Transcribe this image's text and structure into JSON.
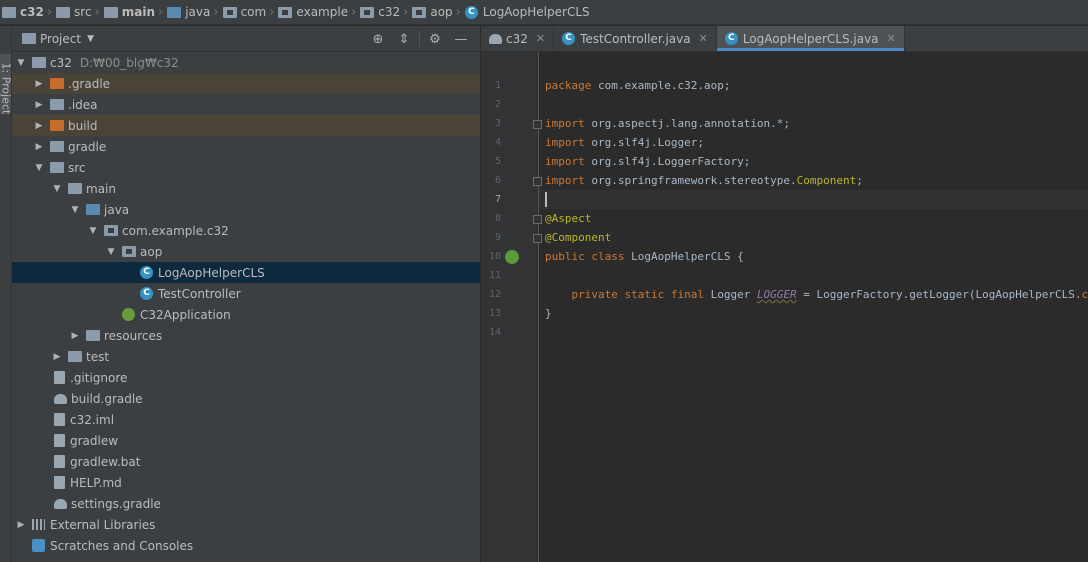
{
  "breadcrumb": [
    {
      "label": "c32",
      "icon": "folder-icon"
    },
    {
      "label": "src",
      "icon": "folder-icon"
    },
    {
      "label": "main",
      "icon": "folder-icon"
    },
    {
      "label": "java",
      "icon": "source-folder-icon"
    },
    {
      "label": "com",
      "icon": "package-icon"
    },
    {
      "label": "example",
      "icon": "package-icon"
    },
    {
      "label": "c32",
      "icon": "package-icon"
    },
    {
      "label": "aop",
      "icon": "package-icon"
    },
    {
      "label": "LogAopHelperCLS",
      "icon": "class-icon"
    }
  ],
  "side_tab": {
    "label": "1: Project"
  },
  "project_panel": {
    "title": "Project",
    "root": {
      "label": "c32",
      "path": "D:₩00_blg₩c32"
    },
    "items": [
      {
        "label": ".gradle"
      },
      {
        "label": ".idea"
      },
      {
        "label": "build"
      },
      {
        "label": "gradle"
      },
      {
        "label": "src"
      },
      {
        "label": "main"
      },
      {
        "label": "java"
      },
      {
        "label": "com.example.c32"
      },
      {
        "label": "aop"
      },
      {
        "label": "LogAopHelperCLS"
      },
      {
        "label": "TestController"
      },
      {
        "label": "C32Application"
      },
      {
        "label": "resources"
      },
      {
        "label": "test"
      },
      {
        "label": ".gitignore"
      },
      {
        "label": "build.gradle"
      },
      {
        "label": "c32.iml"
      },
      {
        "label": "gradlew"
      },
      {
        "label": "gradlew.bat"
      },
      {
        "label": "HELP.md"
      },
      {
        "label": "settings.gradle"
      },
      {
        "label": "External Libraries"
      },
      {
        "label": "Scratches and Consoles"
      }
    ]
  },
  "editor": {
    "tabs": [
      {
        "label": "c32",
        "active": false
      },
      {
        "label": "TestController.java",
        "active": false
      },
      {
        "label": "LogAopHelperCLS.java",
        "active": true
      }
    ],
    "current_line": 7,
    "line_numbers": [
      "1",
      "2",
      "3",
      "4",
      "5",
      "6",
      "7",
      "8",
      "9",
      "10",
      "11",
      "12",
      "13",
      "14"
    ],
    "code": {
      "l1_kw": "package",
      "l1_rest": " com.example.c32.aop;",
      "l3_kw": "import",
      "l3_rest": " org.aspectj.lang.annotation.*;",
      "l4_kw": "import",
      "l4_rest": " org.slf4j.Logger;",
      "l5_kw": "import",
      "l5_rest": " org.slf4j.LoggerFactory;",
      "l6_kw": "import",
      "l6_rest": " org.springframework.stereotype.",
      "l6_ann": "Component",
      "l6_end": ";",
      "l8": "@Aspect",
      "l9": "@Component",
      "l10_kw": "public class",
      "l10_rest": " LogAopHelperCLS {",
      "l12_kw": "    private static final",
      "l12_type": " Logger ",
      "l12_const": "LOGGER",
      "l12_mid": " = LoggerFactory.getLogger(LogAopHelperCLS.",
      "l12_kw2": "class",
      "l12_end": ");",
      "l13": "}"
    }
  },
  "colors": {
    "accent": "#4a88c7",
    "keyword": "#cc7832",
    "annotation": "#bbb529",
    "selection": "#0d293e"
  }
}
